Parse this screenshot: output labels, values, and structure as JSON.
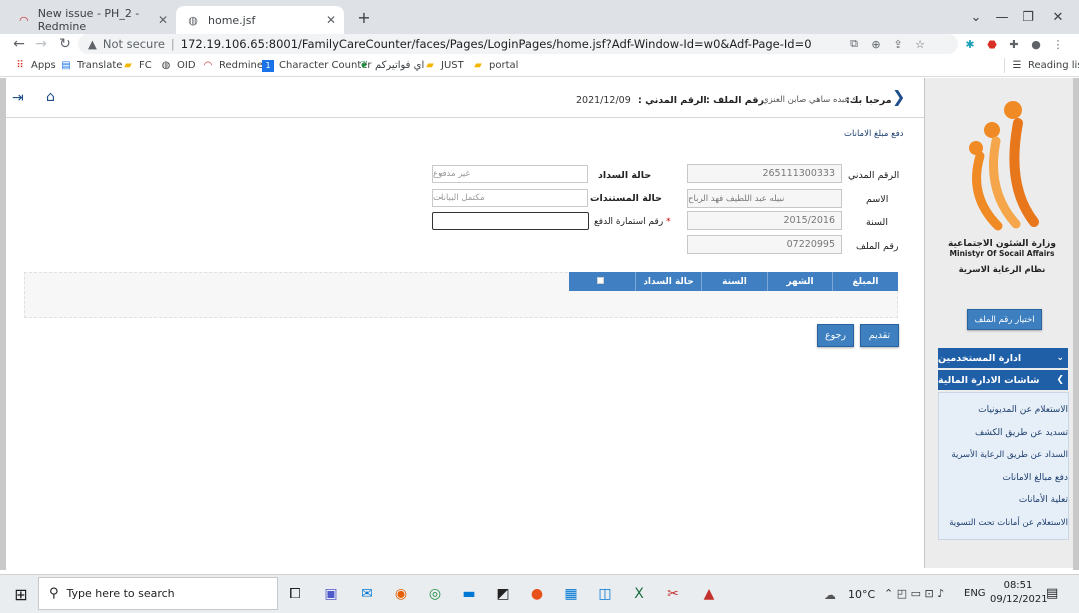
{
  "browser": {
    "tabs": [
      {
        "title": "New issue - PH_2 - Redmine",
        "active": false
      },
      {
        "title": "home.jsf",
        "active": true
      }
    ],
    "new_tab": "+",
    "window_controls": {
      "minimize": "⌄",
      "min": "—",
      "max": "❐",
      "close": "✕"
    },
    "security": "Not secure",
    "url": "172.19.106.65:8001/FamilyCareCounter/faces/Pages/LoginPages/home.jsf?Adf-Window-Id=w0&Adf-Page-Id=0",
    "bookmarks": [
      "Apps",
      "Translate",
      "FC",
      "OID",
      "Redmine",
      "Character Counter",
      "اي فواتيركم",
      "JUST",
      "portal"
    ],
    "reading_list": "Reading list"
  },
  "header": {
    "welcome_label": "مرحبا بك:",
    "welcome_name": "عبده ساهي صابن العنزي",
    "file_no_label": "رقم الملف :",
    "civil_no_label": "الرقم المدني :",
    "date": "2021/12/09"
  },
  "page": {
    "breadcrumb": "دفع مبلغ الامانات",
    "civil_no_label": "الرقم المدني",
    "civil_no_value": "265111300333",
    "name_label": "الاسم",
    "name_value": "نبيله عبد اللطيف فهد الرباح",
    "year_label": "السنة",
    "year_value": "2015/2016",
    "file_label": "رقم الملف",
    "file_value": "07220995",
    "payment_status_label": "حالة السداد",
    "payment_status_value": "غير مدفوع",
    "docs_status_label": "حالة المستندات",
    "docs_status_value": "مكتمل البيانات",
    "payment_form_label": "رقم استمارة الدفع",
    "required_mark": "*",
    "table_headers": [
      "المبلغ",
      "الشهر",
      "السنة",
      "حالة السداد"
    ],
    "submit": "تقديم",
    "back": "رجوع"
  },
  "sidebar": {
    "ministry_ar": "وزارة الشئون الاجتماعية",
    "ministry_en": "Ministyr Of Socail Affairs",
    "system_name": "نظام الرعاية الاسرية",
    "choose_file_btn": "اختيار رقم الملف",
    "menu_users": "ادارة المستخدمين",
    "menu_finance": "شاشات الادارة المالية",
    "items": [
      "الاستعلام عن المديونيات",
      "تسديد عن طريق الكشف",
      "السداد عن طريق الرعاية الأسرية",
      "دفع مبالغ الامانات",
      "تعلية الأمانات",
      "الاستعلام عن أمانات تحت التسوية"
    ]
  },
  "taskbar": {
    "search_placeholder": "Type here to search",
    "temperature": "10°C",
    "lang": "ENG",
    "time": "08:51",
    "date": "09/12/2021"
  },
  "colors": {
    "accent": "#3d7fbf",
    "menu_header": "#1f5fa8",
    "table_header": "#3f7fc2",
    "logo_orange": "#f08a24"
  }
}
